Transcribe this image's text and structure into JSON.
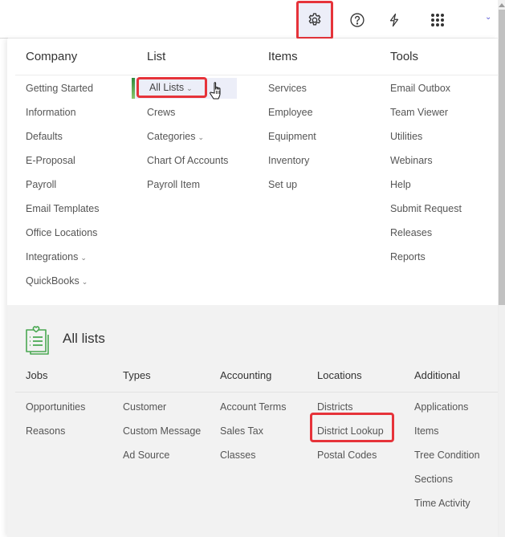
{
  "topbar": {
    "icons": [
      "gear-icon",
      "help-circle-icon",
      "lightning-icon",
      "apps-grid-icon"
    ],
    "chevron": "⌄"
  },
  "menu": {
    "columns": [
      {
        "heading": "Company",
        "items": [
          {
            "label": "Getting Started"
          },
          {
            "label": "Information"
          },
          {
            "label": "Defaults"
          },
          {
            "label": "E-Proposal"
          },
          {
            "label": "Payroll"
          },
          {
            "label": "Email Templates"
          },
          {
            "label": "Office Locations"
          },
          {
            "label": "Integrations",
            "caret": "⌄"
          },
          {
            "label": "QuickBooks",
            "caret": "⌄"
          }
        ]
      },
      {
        "heading": "List",
        "items": [
          {
            "label": "All Lists",
            "caret": "⌄",
            "active": true
          },
          {
            "label": "Crews"
          },
          {
            "label": "Categories",
            "caret": "⌄"
          },
          {
            "label": "Chart Of Accounts"
          },
          {
            "label": "Payroll Item"
          }
        ]
      },
      {
        "heading": "Items",
        "items": [
          {
            "label": "Services"
          },
          {
            "label": "Employee"
          },
          {
            "label": "Equipment"
          },
          {
            "label": "Inventory"
          },
          {
            "label": "Set up"
          }
        ]
      },
      {
        "heading": "Tools",
        "items": [
          {
            "label": "Email Outbox"
          },
          {
            "label": "Team Viewer"
          },
          {
            "label": "Utilities"
          },
          {
            "label": "Webinars"
          },
          {
            "label": "Help"
          },
          {
            "label": "Submit Request"
          },
          {
            "label": "Releases"
          },
          {
            "label": "Reports"
          }
        ]
      }
    ]
  },
  "all_lists": {
    "title": "All lists",
    "columns": [
      {
        "heading": "Jobs",
        "items": [
          "Opportunities",
          "Reasons"
        ]
      },
      {
        "heading": "Types",
        "items": [
          "Customer",
          "Custom Message",
          "Ad Source"
        ]
      },
      {
        "heading": "Accounting",
        "items": [
          "Account Terms",
          "Sales Tax",
          "Classes"
        ]
      },
      {
        "heading": "Locations",
        "items": [
          "Districts",
          "District Lookup",
          "Postal Codes"
        ]
      },
      {
        "heading": "Additional",
        "items": [
          "Applications",
          "Items",
          "Tree Condition",
          "Sections",
          "Time Activity"
        ]
      }
    ],
    "highlighted_item": "District Lookup"
  },
  "colors": {
    "highlight_border": "#e6333a",
    "accent_green": "#2e8b3c",
    "active_bg": "#eceef8",
    "chevron": "#5b5bd6"
  }
}
